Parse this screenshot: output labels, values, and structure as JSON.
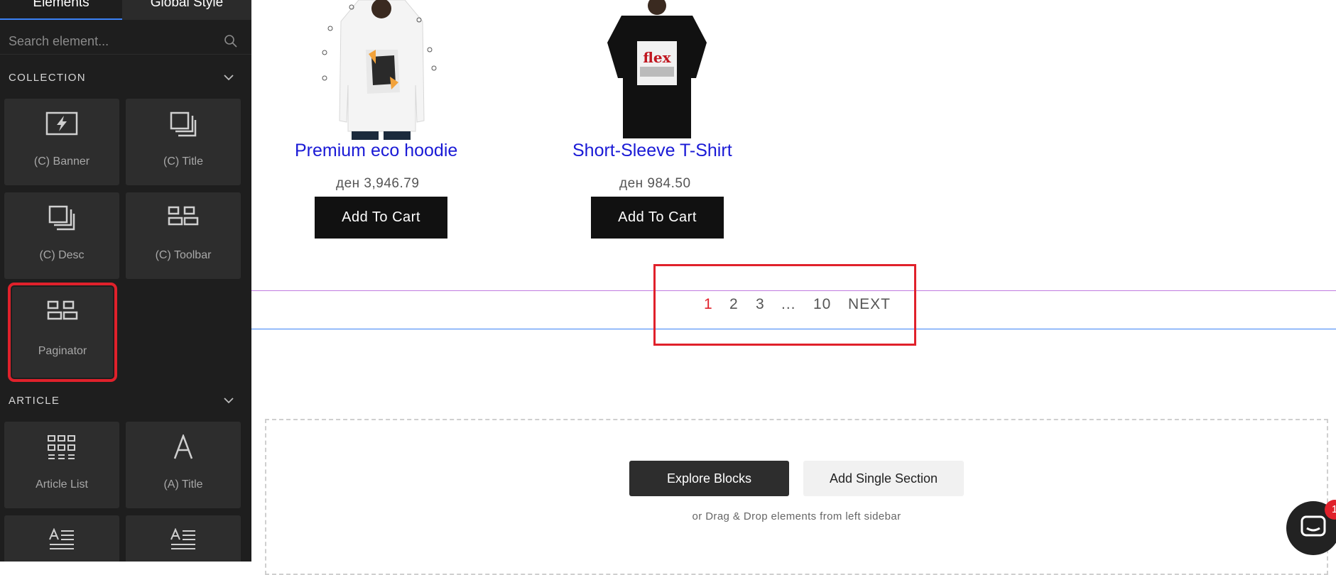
{
  "sidebar": {
    "tabs": [
      {
        "label": "Elements"
      },
      {
        "label": "Global Style"
      }
    ],
    "search": {
      "placeholder": "Search element..."
    },
    "sections": [
      {
        "title": "COLLECTION",
        "items": [
          {
            "label": "(C) Banner",
            "icon": "banner-icon"
          },
          {
            "label": "(C) Title",
            "icon": "stacked-squares-icon"
          },
          {
            "label": "(C) Desc",
            "icon": "stacked-squares-icon"
          },
          {
            "label": "(C) Toolbar",
            "icon": "toolbar-grid-icon"
          },
          {
            "label": "Paginator",
            "icon": "toolbar-grid-icon"
          }
        ]
      },
      {
        "title": "ARTICLE",
        "items": [
          {
            "label": "Article List",
            "icon": "article-grid-icon"
          },
          {
            "label": "(A) Title",
            "icon": "letter-a-icon"
          },
          {
            "label": "",
            "icon": "text-lines-icon"
          },
          {
            "label": "",
            "icon": "text-lines-icon"
          }
        ]
      }
    ]
  },
  "products": [
    {
      "title": "Premium eco hoodie",
      "price": "ден 3,946.79",
      "button": "Add To Cart"
    },
    {
      "title": "Short-Sleeve T-Shirt",
      "price": "ден 984.50",
      "button": "Add To Cart"
    }
  ],
  "tshirt_print": "flex",
  "paginator": {
    "pages": [
      "1",
      "2",
      "3",
      "...",
      "10"
    ],
    "active": "1",
    "next": "NEXT"
  },
  "dropzone": {
    "explore": "Explore Blocks",
    "single": "Add Single Section",
    "hint": "or Drag & Drop elements from left sidebar"
  },
  "chat": {
    "badge": "1"
  },
  "colors": {
    "highlight": "#e0212b",
    "link": "#1a1ad6",
    "sidebar_bg": "#1e1e1e",
    "guide_purple": "#c07be0",
    "guide_blue": "#3b82f6"
  }
}
